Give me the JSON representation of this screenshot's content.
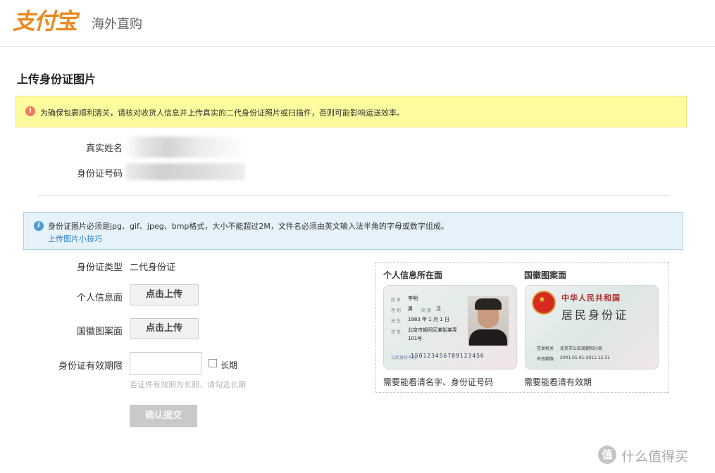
{
  "header": {
    "logo_text": "支付宝",
    "logo_subtitle": "海外直购"
  },
  "page_title": "上传身份证图片",
  "warning": {
    "icon": "exclamation-icon",
    "text": "为确保包裹顺利清关，请核对收货人信息并上传真实的二代身份证照片或扫描件，否则可能影响运送效率。"
  },
  "identity": {
    "name_label": "真实姓名",
    "id_label": "身份证号码"
  },
  "info": {
    "icon": "info-icon",
    "text": "身份证图片必须是jpg、gif、jpeg、bmp格式，大小不能超过2M，文件名必须由英文输入法半角的字母或数字组成。",
    "link": "上传图片小技巧"
  },
  "form": {
    "id_type_label": "身份证类型",
    "id_type_value": "二代身份证",
    "personal_side_label": "个人信息面",
    "personal_upload": "点击上传",
    "emblem_side_label": "国徽图案面",
    "emblem_upload": "点击上传",
    "validity_label": "身份证有效期限",
    "long_term_label": "长期",
    "hint": "若证件有效期为长期，请勾选长期",
    "submit": "确认提交"
  },
  "sample": {
    "front_title": "个人信息所在面",
    "back_title": "国徽图案面",
    "front_caption": "需要能看清名字、身份证号码",
    "back_caption": "需要能看清有效期",
    "front_card": {
      "name_label": "姓 名",
      "name": "李明",
      "sex_label": "性 别",
      "sex": "男",
      "ethnic_label": "民 族",
      "ethnic": "汉",
      "birth_label": "出 生",
      "birth": "1983 年 1 月 1 日",
      "addr_label": "住 址",
      "addr1": "北京市朝阳区某街某弄",
      "addr2": "101号",
      "id_label": "公民身份号码",
      "id_number": "150123456789123456"
    },
    "back_card": {
      "title1": "中华人民共和国",
      "title2": "居民身份证",
      "issuer_label": "签发机关",
      "issuer": "北京市公安局朝阳分局",
      "valid_label": "有效期限",
      "valid": "2001.01.01-2011.12.31"
    }
  },
  "watermark": {
    "icon": "zhi-icon",
    "text": "什么值得买",
    "icon_char": "值"
  },
  "colors": {
    "brand_orange": "#e98a1e",
    "warning_bg": "#fdfc9e",
    "info_bg": "#e5f2f9",
    "link_blue": "#2a7fc9"
  }
}
